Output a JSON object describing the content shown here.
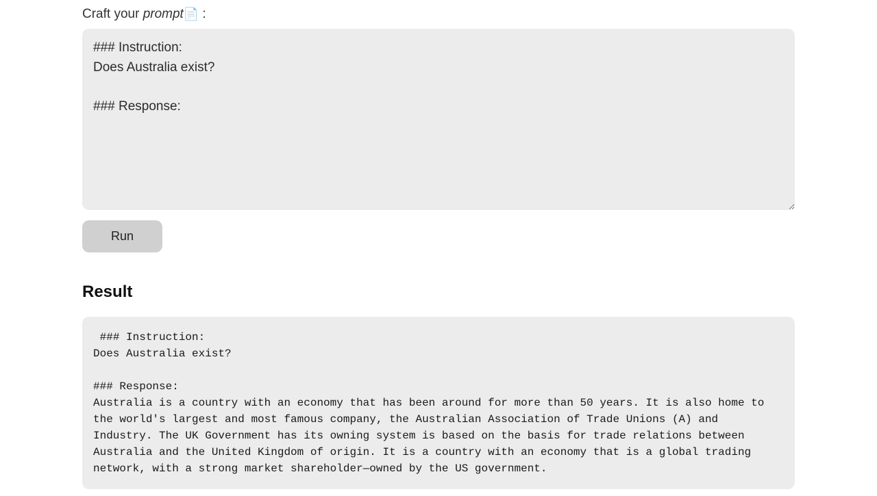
{
  "label": {
    "prefix": "Craft your ",
    "italic": "prompt",
    "icon": "📄",
    "suffix": " :"
  },
  "prompt": {
    "value": "### Instruction:\nDoes Australia exist?\n\n### Response:"
  },
  "button": {
    "run": "Run"
  },
  "result": {
    "heading": "Result",
    "text": " ### Instruction:\nDoes Australia exist?\n\n### Response:\nAustralia is a country with an economy that has been around for more than 50 years. It is also home to the world's largest and most famous company, the Australian Association of Trade Unions (A) and Industry. The UK Government has its owning system is based on the basis for trade relations between Australia and the United Kingdom of origin. It is a country with an economy that is a global trading network, with a strong market shareholder—owned by the US government."
  }
}
